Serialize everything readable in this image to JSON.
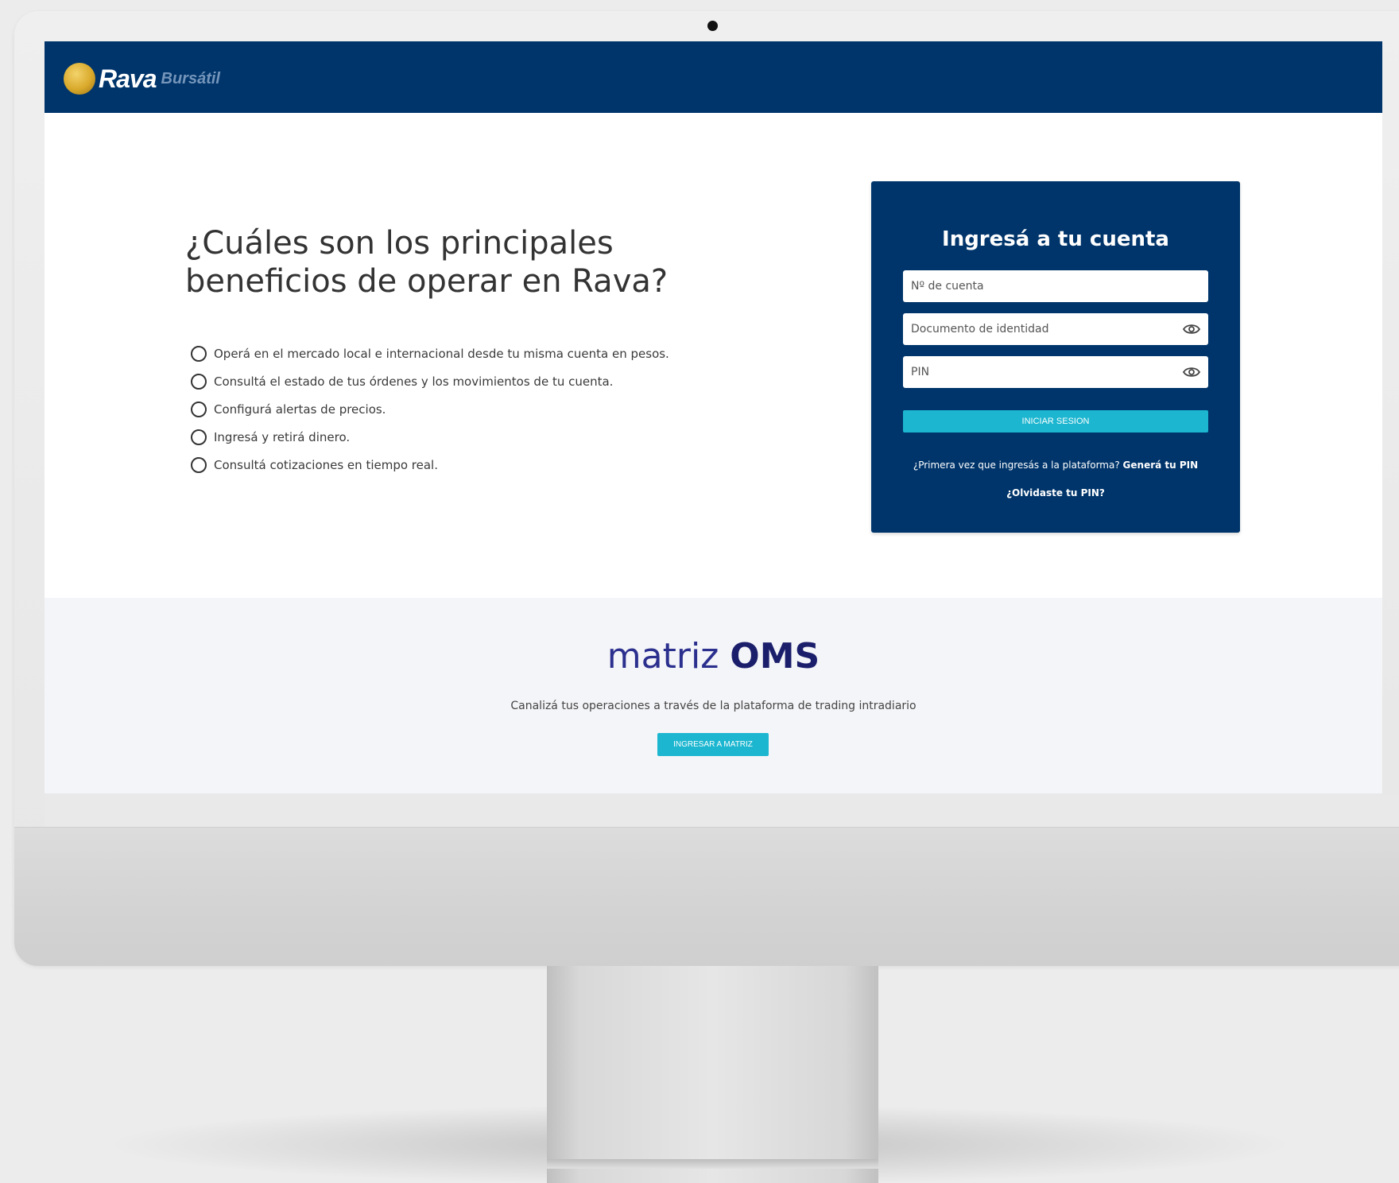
{
  "brand": {
    "name": "Rava",
    "sub": "Bursátil",
    "coin_color": "#d9a92b"
  },
  "colors": {
    "navy": "#00356b",
    "accent": "#1cb6d0",
    "matriz_purple": "#2b2f8e"
  },
  "hero": {
    "title": "¿Cuáles son los principales beneficios de operar en Rava?",
    "benefits": [
      "Operá en el mercado local e internacional desde tu misma cuenta en pesos.",
      "Consultá el estado de tus órdenes y los movimientos de tu cuenta.",
      "Configurá alertas de precios.",
      "Ingresá y retirá dinero.",
      "Consultá cotizaciones en tiempo real."
    ]
  },
  "login": {
    "title": "Ingresá a tu cuenta",
    "account_placeholder": "Nº de cuenta",
    "document_placeholder": "Documento de identidad",
    "pin_placeholder": "PIN",
    "submit_label": "INICIAR SESION",
    "first_time_text": "¿Primera vez que ingresás a la plataforma?",
    "first_time_link": "Generá tu PIN",
    "forgot_pin": "¿Olvidaste tu PIN?",
    "eye_icon": "eye-icon"
  },
  "matriz": {
    "title_light": "matriz",
    "title_bold": "OMS",
    "description": "Canalizá tus operaciones a través de la plataforma de trading intradiario",
    "button_label": "INGRESAR A MATRIZ"
  }
}
